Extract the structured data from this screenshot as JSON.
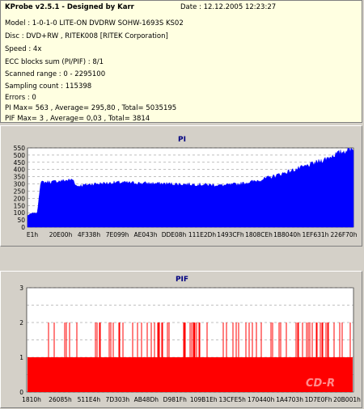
{
  "info": {
    "title": "KProbe v2.5.1 - Designed by Karr",
    "date": "Date : 12.12.2005 12:23:27",
    "lines": [
      "Model : 1-0-1-0 LITE-ON DVDRW SOHW-1693S KS02",
      "Disc : DVD+RW , RITEK008 [RITEK Corporation]",
      "Speed : 4x",
      "ECC blocks sum (PI/PIF) : 8/1",
      "Scanned range : 0 - 2295100",
      "Sampling count : 115398",
      "Errors : 0",
      "PI Max= 563 , Average= 295,80 , Total= 5035195",
      "PIF Max= 3 , Average= 0,03 , Total= 3814"
    ]
  },
  "colors": {
    "background": "#d4d0c8",
    "plot_bg": "#ffffff",
    "pi_fill": "#0000ff",
    "pif_fill": "#ff0000",
    "title_color": "#000080",
    "grid": "#808080"
  },
  "chart_data": [
    {
      "type": "area",
      "title": "PI",
      "ylim": [
        0,
        550
      ],
      "yticks": [
        0,
        50,
        100,
        150,
        200,
        250,
        300,
        350,
        400,
        450,
        500,
        550
      ],
      "xticks": [
        "E1h",
        "20E00h",
        "4F338h",
        "7E099h",
        "AE043h",
        "DDE08h",
        "111E2Dh",
        "1493CFh",
        "1808CEh",
        "1B8040h",
        "1EF631h",
        "226F70h"
      ],
      "x": [
        0,
        0.012,
        0.03,
        0.04,
        0.08,
        0.14,
        0.15,
        0.2,
        0.28,
        0.36,
        0.45,
        0.55,
        0.6,
        0.65,
        0.7,
        0.75,
        0.8,
        0.85,
        0.9,
        0.95,
        1.0
      ],
      "values": [
        80,
        95,
        100,
        310,
        315,
        330,
        285,
        300,
        310,
        305,
        300,
        295,
        290,
        300,
        320,
        350,
        385,
        420,
        460,
        510,
        550
      ],
      "grid": true
    },
    {
      "type": "bar",
      "title": "PIF",
      "ylim": [
        0,
        3
      ],
      "yticks": [
        0,
        0.5,
        1,
        1.5,
        2,
        2.5,
        3
      ],
      "ytick_labels": [
        "0",
        "1",
        "2",
        "3"
      ],
      "xticks": [
        "1810h",
        "26085h",
        "511E4h",
        "7D303h",
        "AB48Dh",
        "D981Fh",
        "109B1Eh",
        "13CFE5h",
        "170440h",
        "1A4703h",
        "1D7E0Fh",
        "20B001h"
      ],
      "baseline": 1,
      "spike_count": 2,
      "grid": true,
      "watermark": "CD-R"
    }
  ]
}
